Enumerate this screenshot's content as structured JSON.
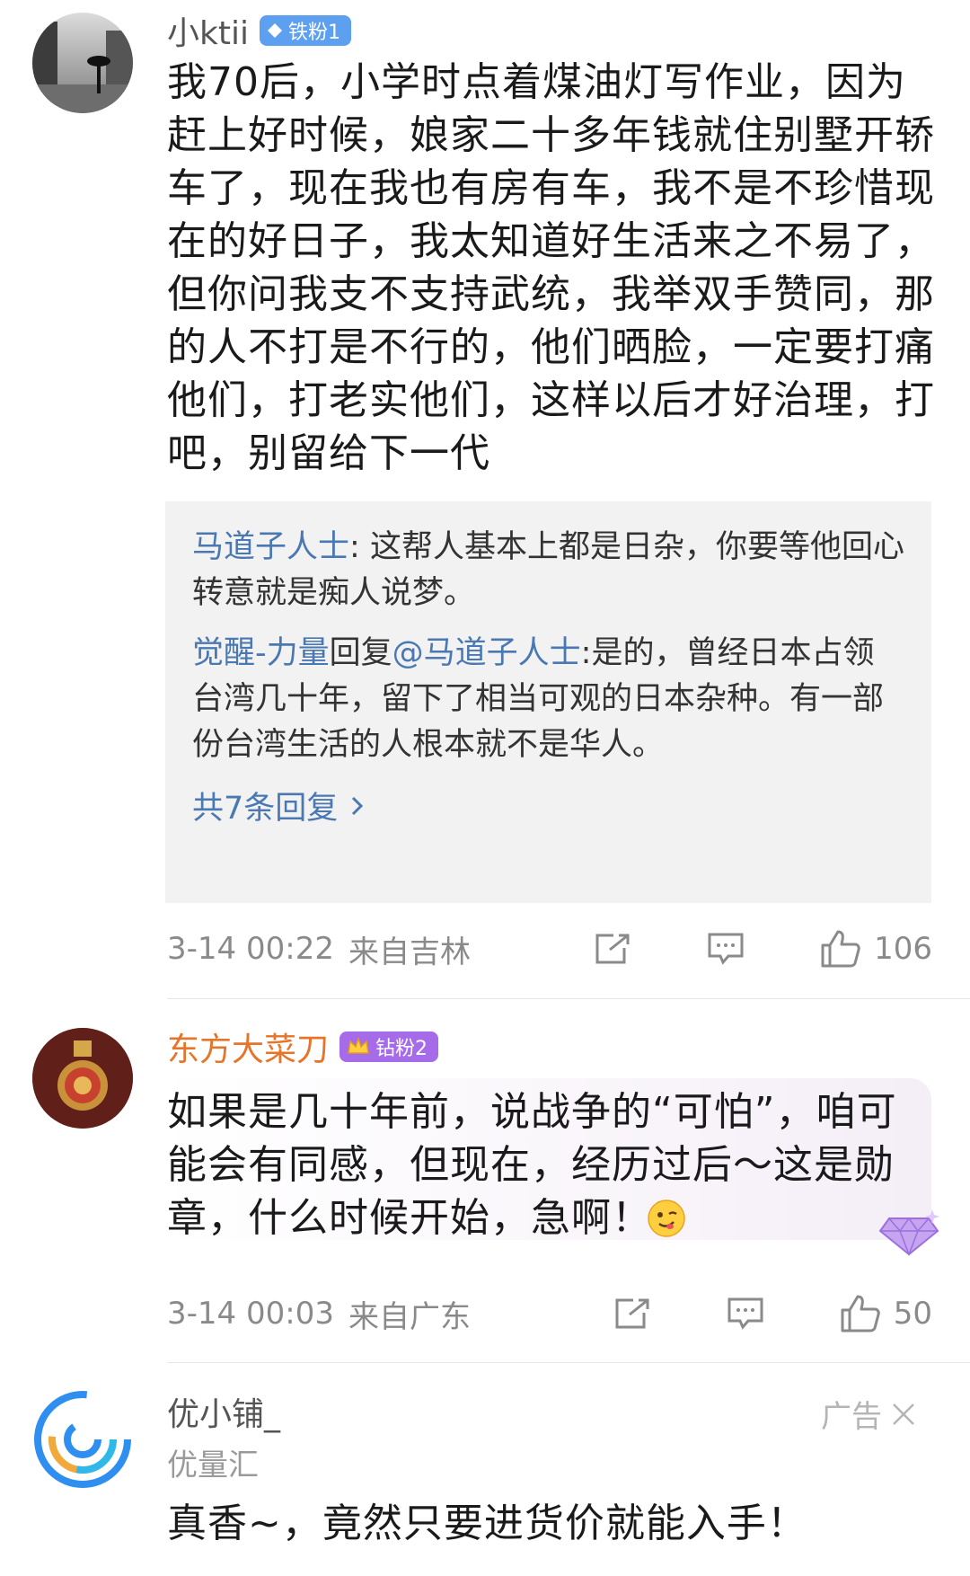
{
  "comments": [
    {
      "username": "小ktii",
      "badge": "铁粉1",
      "text": "我70后，小学时点着煤油灯写作业，因为赶上好时候，娘家二十多年钱就住别墅开轿车了，现在我也有房有车，我不是不珍惜现在的好日子，我太知道好生活来之不易了，但你问我支不支持武统，我举双手赞同，那的人不打是不行的，他们晒脸，一定要打痛他们，打老实他们，这样以后才好治理，打吧，别留给下一代",
      "replies": [
        {
          "nick": "马道子人士",
          "sep": ": ",
          "text": "这帮人基本上都是日杂，你要等他回心转意就是痴人说梦。"
        },
        {
          "nick": "觉醒-力量",
          "mid": "回复",
          "target": "@马道子人士",
          "sep": ":",
          "text": "是的，曾经日本占领台湾几十年，留下了相当可观的日本杂种。有一部份台湾生活的人根本就不是华人。"
        }
      ],
      "reply_count": "共7条回复",
      "time": "3-14 00:22",
      "location": "来自吉林",
      "likes": "106"
    },
    {
      "username": "东方大菜刀",
      "badge": "钻粉2",
      "text": "如果是几十年前，说战争的“可怕”，咱可能会有同感，但现在，经历过后～这是勋章，什么时候开始，急啊！",
      "time": "3-14 00:03",
      "location": "来自广东",
      "likes": "50"
    }
  ],
  "ad": {
    "username": "优小铺_",
    "source": "优量汇",
    "label": "广告",
    "text": "真香~，竟然只要进货价就能入手！"
  },
  "icons": {
    "share": "share-icon",
    "comment": "comment-icon",
    "like": "thumbs-up-icon",
    "close": "close-icon",
    "chevron": "chevron-right-icon"
  },
  "colors": {
    "link": "#4a78b3",
    "orange_name": "#e6752a",
    "meta_gray": "#8a8a8a"
  }
}
